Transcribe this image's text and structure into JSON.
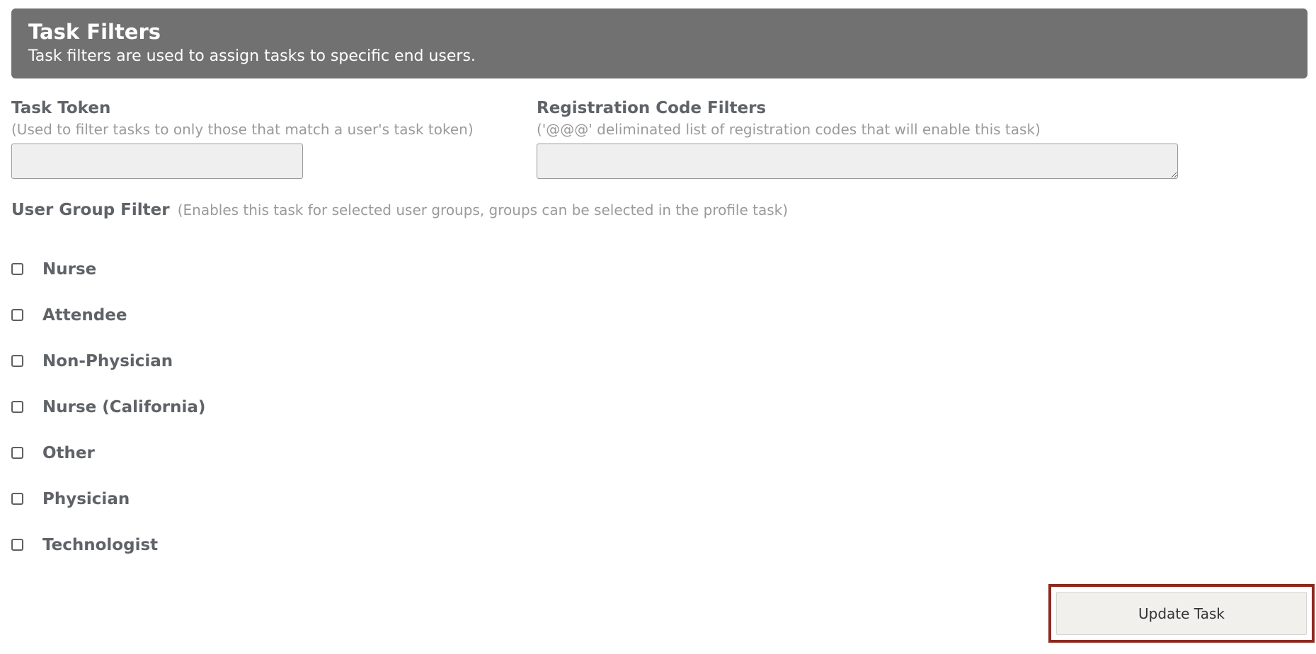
{
  "header": {
    "title": "Task Filters",
    "subtitle": "Task filters are used to assign tasks to specific end users."
  },
  "task_token": {
    "label": "Task Token",
    "hint": "(Used to filter tasks to only those that match a user's task token)",
    "value": ""
  },
  "registration_codes": {
    "label": "Registration Code Filters",
    "hint": "('@@@' deliminated list of registration codes that will enable this task)",
    "value": ""
  },
  "user_group_filter": {
    "label": "User Group Filter",
    "hint": "(Enables this task for selected user groups, groups can be selected in the profile task)",
    "groups": [
      {
        "label": "Nurse",
        "checked": false
      },
      {
        "label": "Attendee",
        "checked": false
      },
      {
        "label": "Non-Physician",
        "checked": false
      },
      {
        "label": "Nurse (California)",
        "checked": false
      },
      {
        "label": "Other",
        "checked": false
      },
      {
        "label": "Physician",
        "checked": false
      },
      {
        "label": "Technologist",
        "checked": false
      }
    ]
  },
  "actions": {
    "update_label": "Update Task"
  },
  "colors": {
    "header_bg": "#717171",
    "label_text": "#5f6368",
    "hint_text": "#9a9a9a",
    "input_bg": "#efefef",
    "highlight_border": "#8b2a1e"
  }
}
